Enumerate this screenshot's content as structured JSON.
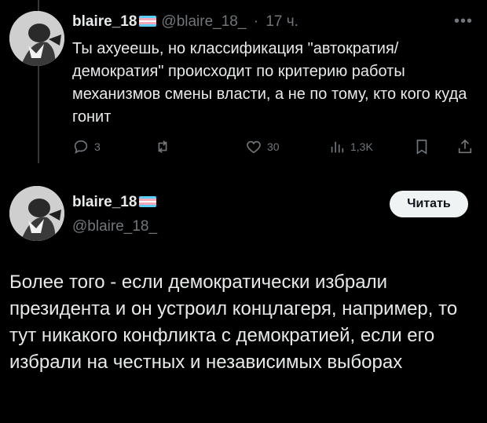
{
  "colors": {
    "background": "#000000",
    "text": "#e7e9ea",
    "muted": "#71767b",
    "button_bg": "#eff3f4",
    "flag": [
      "#5bcefa",
      "#f5a9b8",
      "#ffffff",
      "#f5a9b8",
      "#5bcefa"
    ]
  },
  "reply_tweet": {
    "display_name": "blaire_18",
    "handle": "@blaire_18_",
    "separator": "·",
    "time": "17 ч.",
    "more_icon": "more-icon",
    "text": "Ты ахуеешь, но классификация \"автократия/демократия\" происходит по критерию работы механизмов смены власти, а не по тому, кто кого куда гонит",
    "actions": {
      "reply": {
        "icon": "reply-icon",
        "count": "3"
      },
      "retweet": {
        "icon": "retweet-icon",
        "count": ""
      },
      "like": {
        "icon": "like-icon",
        "count": "30"
      },
      "views": {
        "icon": "views-icon",
        "count": "1,3K"
      },
      "bookmark": {
        "icon": "bookmark-icon"
      },
      "share": {
        "icon": "share-icon"
      }
    }
  },
  "main_tweet": {
    "display_name": "blaire_18",
    "handle": "@blaire_18_",
    "follow_label": "Читать",
    "text": "Более того - если демократически избрали президента и он устроил концлагеря, например, то тут никакого конфликта с демократией, если его избрали на честных и независимых выборах"
  }
}
